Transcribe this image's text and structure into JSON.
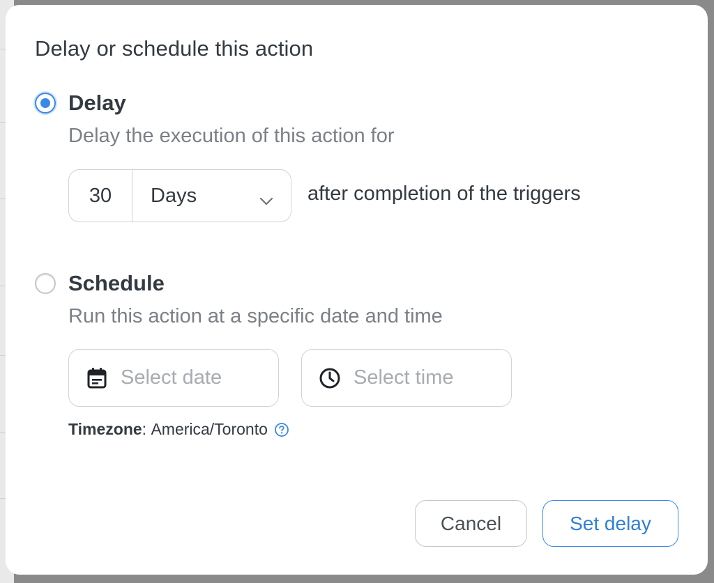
{
  "dialog": {
    "title": "Delay or schedule this action"
  },
  "delay_option": {
    "label": "Delay",
    "selected": true,
    "description": "Delay the execution of this action for",
    "amount": "30",
    "unit": "Days",
    "suffix": "after completion of the triggers"
  },
  "schedule_option": {
    "label": "Schedule",
    "selected": false,
    "description": "Run this action at a specific date and time",
    "date_placeholder": "Select date",
    "time_placeholder": "Select time",
    "timezone_label": "Timezone",
    "timezone_value": "America/Toronto"
  },
  "buttons": {
    "cancel": "Cancel",
    "submit": "Set delay"
  },
  "colors": {
    "accent": "#3a89e6",
    "text": "#333a41",
    "muted": "#7b8087",
    "placeholder": "#a8acb1"
  },
  "icons": {
    "date": "calendar-icon",
    "time": "clock-icon",
    "help": "help-circle-icon",
    "unit_dropdown": "chevron-down-icon"
  }
}
